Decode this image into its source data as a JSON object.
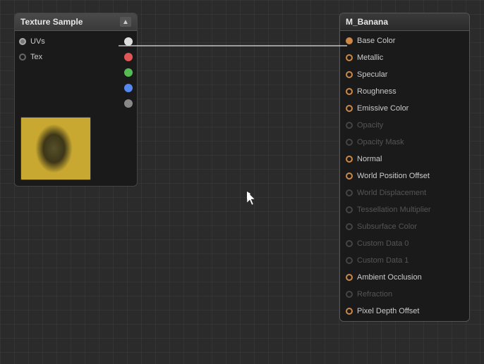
{
  "canvas": {
    "background_color": "#2b2b2b"
  },
  "texture_node": {
    "title": "Texture Sample",
    "collapse_button": "▲",
    "pins_left": [
      {
        "id": "uvs",
        "label": "UVs",
        "connected": true
      },
      {
        "id": "tex",
        "label": "Tex",
        "connected": false
      }
    ],
    "pins_right": [
      {
        "id": "rgba",
        "color": "white"
      },
      {
        "id": "r",
        "color": "red"
      },
      {
        "id": "g",
        "color": "green"
      },
      {
        "id": "b",
        "color": "blue"
      },
      {
        "id": "a",
        "color": "gray"
      }
    ]
  },
  "material_node": {
    "title": "M_Banana",
    "pins": [
      {
        "id": "base-color",
        "label": "Base Color",
        "state": "active-connected"
      },
      {
        "id": "metallic",
        "label": "Metallic",
        "state": "enabled"
      },
      {
        "id": "specular",
        "label": "Specular",
        "state": "enabled"
      },
      {
        "id": "roughness",
        "label": "Roughness",
        "state": "enabled"
      },
      {
        "id": "emissive-color",
        "label": "Emissive Color",
        "state": "enabled"
      },
      {
        "id": "opacity",
        "label": "Opacity",
        "state": "disabled"
      },
      {
        "id": "opacity-mask",
        "label": "Opacity Mask",
        "state": "disabled"
      },
      {
        "id": "normal",
        "label": "Normal",
        "state": "enabled"
      },
      {
        "id": "world-position-offset",
        "label": "World Position Offset",
        "state": "enabled"
      },
      {
        "id": "world-displacement",
        "label": "World Displacement",
        "state": "disabled"
      },
      {
        "id": "tessellation-multiplier",
        "label": "Tessellation Multiplier",
        "state": "disabled"
      },
      {
        "id": "subsurface-color",
        "label": "Subsurface Color",
        "state": "disabled"
      },
      {
        "id": "custom-data-0",
        "label": "Custom Data 0",
        "state": "disabled"
      },
      {
        "id": "custom-data-1",
        "label": "Custom Data 1",
        "state": "disabled"
      },
      {
        "id": "ambient-occlusion",
        "label": "Ambient Occlusion",
        "state": "enabled"
      },
      {
        "id": "refraction",
        "label": "Refraction",
        "state": "disabled"
      },
      {
        "id": "pixel-depth-offset",
        "label": "Pixel Depth Offset",
        "state": "enabled"
      }
    ]
  }
}
